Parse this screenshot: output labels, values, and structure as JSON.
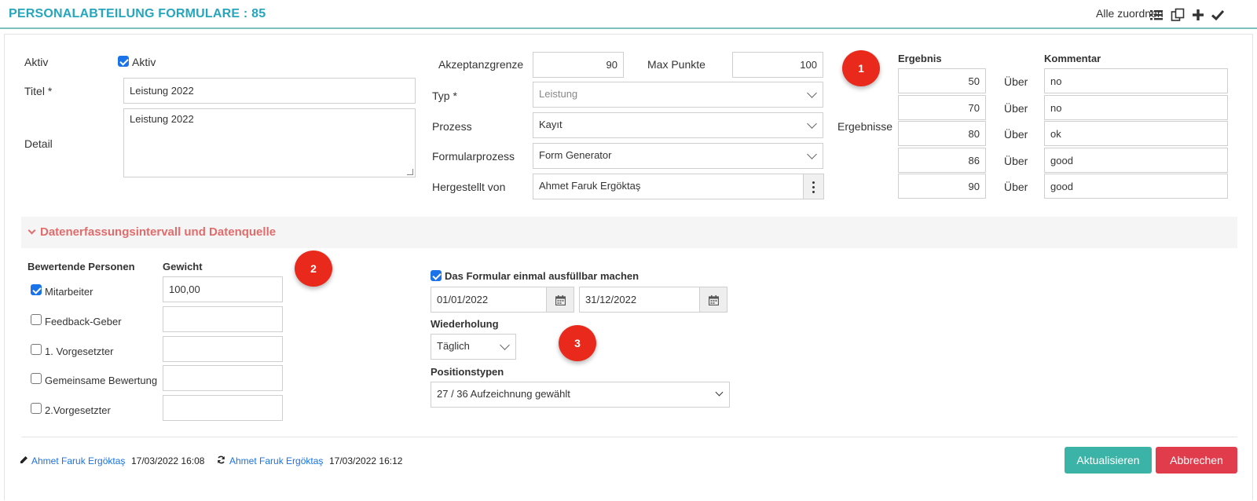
{
  "header": {
    "title": "PERSONALABTEILUNG FORMULARE : 85",
    "assign_all": "Alle zuordnen",
    "icons": [
      "list-icon",
      "copy-icon",
      "plus-icon",
      "check-icon"
    ]
  },
  "form": {
    "aktiv_label": "Aktiv",
    "aktiv_checkbox_label": "Aktiv",
    "aktiv_checked": true,
    "titel_label": "Titel *",
    "titel_value": "Leistung 2022",
    "detail_label": "Detail",
    "detail_value": "Leistung 2022",
    "akzeptanz_label": "Akzeptanzgrenze",
    "akzeptanz_value": "90",
    "max_label": "Max Punkte",
    "max_value": "100",
    "typ_label": "Typ *",
    "typ_value": "Leistung",
    "prozess_label": "Prozess",
    "prozess_value": "Kayıt",
    "formularprozess_label": "Formularprozess",
    "formularprozess_value": "Form Generator",
    "hergestellt_label": "Hergestellt von",
    "hergestellt_value": "Ahmet Faruk Ergöktaş"
  },
  "results": {
    "row_label": "Ergebnisse",
    "ergebnis_header": "Ergebnis",
    "kommentar_header": "Kommentar",
    "rows": [
      {
        "value": "50",
        "op": "Über",
        "comment": "no"
      },
      {
        "value": "70",
        "op": "Über",
        "comment": "no"
      },
      {
        "value": "80",
        "op": "Über",
        "comment": "ok"
      },
      {
        "value": "86",
        "op": "Über",
        "comment": "good"
      },
      {
        "value": "90",
        "op": "Über",
        "comment": "good"
      }
    ]
  },
  "badges": [
    "1",
    "2",
    "3"
  ],
  "section": {
    "title": "Datenerfassungsintervall und Datenquelle"
  },
  "evaluators": {
    "header_persons": "Bewertende Personen",
    "header_weight": "Gewicht",
    "rows": [
      {
        "label": "Mitarbeiter",
        "checked": true,
        "weight": "100,00"
      },
      {
        "label": "Feedback-Geber",
        "checked": false,
        "weight": ""
      },
      {
        "label": "1. Vorgesetzter",
        "checked": false,
        "weight": ""
      },
      {
        "label": "Gemeinsame Bewertung",
        "checked": false,
        "weight": ""
      },
      {
        "label": "2.Vorgesetzter",
        "checked": false,
        "weight": ""
      }
    ]
  },
  "schedule": {
    "once_label": "Das Formular einmal ausfüllbar machen",
    "once_checked": true,
    "date_from": "01/01/2022",
    "date_to": "31/12/2022",
    "repeat_label": "Wiederholung",
    "repeat_value": "Täglich",
    "positions_label": "Positionstypen",
    "positions_value": "27 / 36 Aufzeichnung gewählt"
  },
  "footer": {
    "created_by": "Ahmet Faruk Ergöktaş",
    "created_at": "17/03/2022 16:08",
    "updated_by": "Ahmet Faruk Ergöktaş",
    "updated_at": "17/03/2022 16:12",
    "update_button": "Aktualisieren",
    "cancel_button": "Abbrechen"
  },
  "colors": {
    "title": "#26a6bd",
    "section": "#e06c6c",
    "primary": "#3bb3a7",
    "danger": "#e03c4b",
    "badge": "#e8291b",
    "link": "#1a73e8"
  }
}
